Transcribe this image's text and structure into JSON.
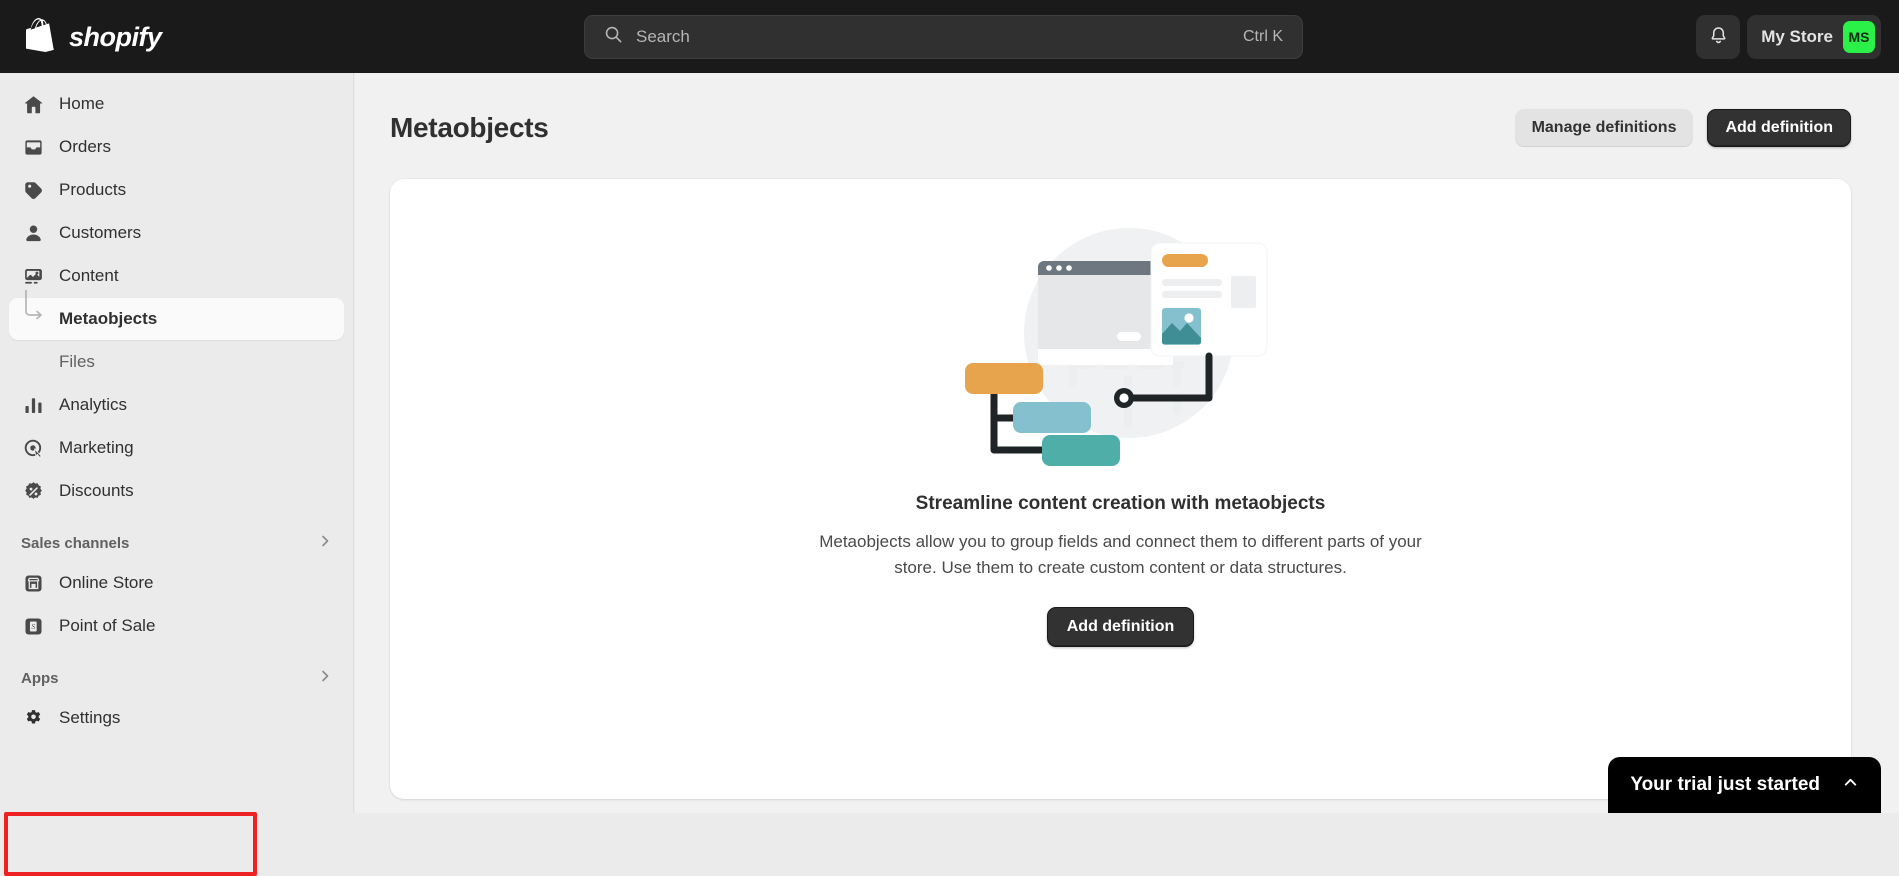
{
  "topbar": {
    "logo_text": "shopify",
    "logo_icon": "shopify-bag-icon",
    "search": {
      "placeholder": "Search",
      "value": "",
      "shortcut": "Ctrl K",
      "icon": "search-icon"
    },
    "notifications_icon": "bell-icon",
    "store": {
      "name": "My Store",
      "initials": "MS",
      "avatar_color": "#2bf048"
    }
  },
  "sidebar": {
    "items": [
      {
        "label": "Home",
        "icon": "home-icon",
        "active": false
      },
      {
        "label": "Orders",
        "icon": "orders-inbox-icon",
        "active": false
      },
      {
        "label": "Products",
        "icon": "product-tag-icon",
        "active": false
      },
      {
        "label": "Customers",
        "icon": "person-icon",
        "active": false
      },
      {
        "label": "Content",
        "icon": "content-image-icon",
        "active": false
      }
    ],
    "content_children": [
      {
        "label": "Metaobjects",
        "active": true
      },
      {
        "label": "Files",
        "active": false
      }
    ],
    "items2": [
      {
        "label": "Analytics",
        "icon": "bar-chart-icon",
        "active": false
      },
      {
        "label": "Marketing",
        "icon": "marketing-target-icon",
        "active": false
      },
      {
        "label": "Discounts",
        "icon": "discount-badge-icon",
        "active": false
      }
    ],
    "sales_channels": {
      "title": "Sales channels",
      "chevron_icon": "chevron-right-icon",
      "items": [
        {
          "label": "Online Store",
          "icon": "storefront-icon"
        },
        {
          "label": "Point of Sale",
          "icon": "point-of-sale-icon"
        }
      ]
    },
    "apps": {
      "title": "Apps",
      "chevron_icon": "chevron-right-icon"
    },
    "settings": {
      "label": "Settings",
      "icon": "gear-icon"
    },
    "annotation_color": "#ee2222"
  },
  "main": {
    "page_title": "Metaobjects",
    "header_buttons": {
      "manage": "Manage definitions",
      "add": "Add definition"
    },
    "empty_state": {
      "illustration_name": "metaobjects-diagram-illustration",
      "title": "Streamline content creation with metaobjects",
      "body": "Metaobjects allow you to group fields and connect them to different parts of your store. Use them to create custom content or data structures.",
      "cta": "Add definition",
      "colors": {
        "orange": "#e8a44d",
        "light_blue": "#84c0cd",
        "teal": "#4fafa8",
        "dark": "#1f2426",
        "grey": "#e5e7e9",
        "browser_bar": "#6e7780"
      }
    }
  },
  "trial_banner": {
    "text": "Your trial just started",
    "chevron_icon": "chevron-up-icon"
  }
}
